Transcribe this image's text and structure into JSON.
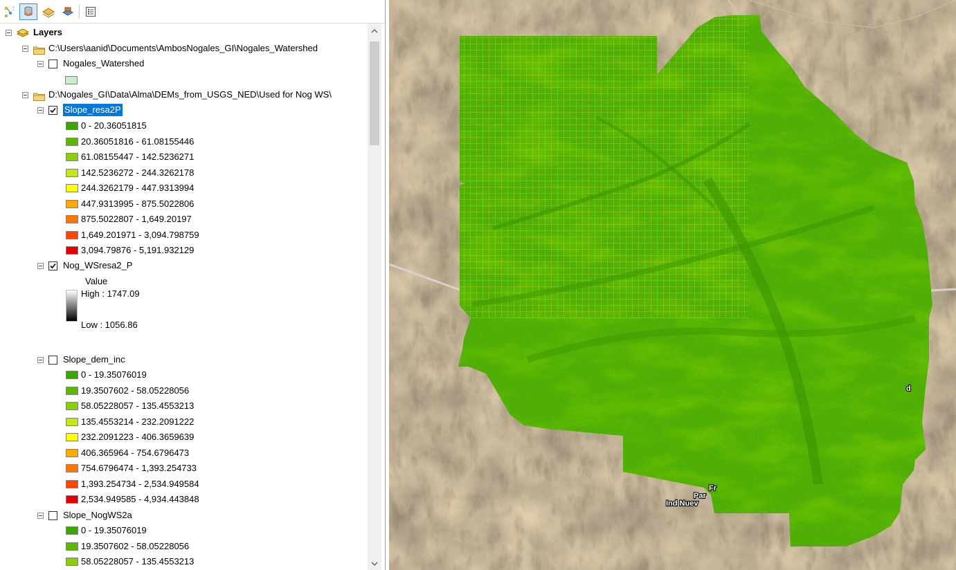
{
  "toolbar": {
    "buttons": [
      {
        "name": "list-by-drawing-order-icon"
      },
      {
        "name": "list-by-source-icon"
      },
      {
        "name": "list-by-visibility-icon"
      },
      {
        "name": "list-by-selection-icon"
      },
      {
        "name": "options-icon"
      }
    ]
  },
  "toc": {
    "root_label": "Layers",
    "folder1": "C:\\Users\\aanid\\Documents\\AmbosNogales_GI\\Nogales_Watershed",
    "layer_watershed": "Nogales_Watershed",
    "folder2": "D:\\Nogales_GI\\Data\\Alma\\DEMs_from_USGS_NED\\Used for Nog WS\\",
    "layer_slope_resa2p": "Slope_resa2P",
    "slope_resa2p_classes": [
      "0 - 20.36051815",
      "20.36051816 - 61.08155446",
      "61.08155447 - 142.5236271",
      "142.5236272 - 244.3262178",
      "244.3262179 - 447.9313994",
      "447.9313995 - 875.5022806",
      "875.5022807 - 1,649.20197",
      "1,649.201971 - 3,094.798759",
      "3,094.79876 - 5,191.932129"
    ],
    "layer_nog_ws": "Nog_WSresa2_P",
    "value_label": "Value",
    "high_label": "High : 1747.09",
    "low_label": "Low : 1056.86",
    "layer_slope_dem": "Slope_dem_inc",
    "slope_dem_classes": [
      "0 - 19.35076019",
      "19.3507602 - 58.05228056",
      "58.05228057 - 135.4553213",
      "135.4553214 - 232.2091222",
      "232.2091223 - 406.3659639",
      "406.365964 - 754.6796473",
      "754.6796474 - 1,393.254733",
      "1,393.254734 - 2,534.949584",
      "2,534.949585 - 4,934.443848"
    ],
    "layer_slope_nogws": "Slope_NogWS2a",
    "slope_nogws_classes": [
      "0 - 19.35076019",
      "19.3507602 - 58.05228056",
      "58.05228057 - 135.4553213"
    ],
    "class_colors": [
      "#38a800",
      "#5bb800",
      "#8ccd0e",
      "#c7e617",
      "#ffff00",
      "#ffaa00",
      "#ff7700",
      "#ff4400",
      "#e60000"
    ]
  },
  "map": {
    "label_lines": [
      "Fr",
      "Par",
      "Ind Nuev"
    ],
    "label_right": "d"
  }
}
